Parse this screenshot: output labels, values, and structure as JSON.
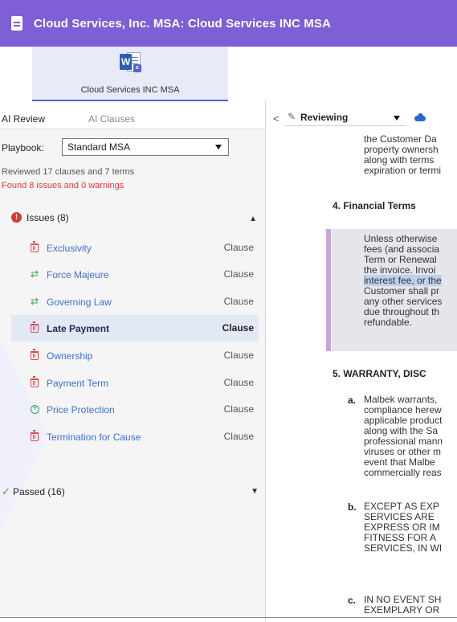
{
  "header": {
    "title": "Cloud Services, Inc. MSA: Cloud Services INC MSA"
  },
  "document_tab": {
    "label": "Cloud Services INC MSA"
  },
  "tabs": [
    {
      "label": "AI Review"
    },
    {
      "label": "AI Clauses"
    }
  ],
  "playbook": {
    "label": "Playbook:",
    "selected": "Standard MSA"
  },
  "summary": {
    "reviewed": "Reviewed 17 clauses and 7 terms",
    "found": "Found 8 issues and 0 warnings"
  },
  "issues": {
    "title": "Issues (8)",
    "items": [
      {
        "name": "Exclusivity",
        "kind": "Clause",
        "icon": "trash-icon"
      },
      {
        "name": "Force Majeure",
        "kind": "Clause",
        "icon": "swap-icon"
      },
      {
        "name": "Governing Law",
        "kind": "Clause",
        "icon": "swap-icon"
      },
      {
        "name": "Late Payment",
        "kind": "Clause",
        "icon": "trash-icon"
      },
      {
        "name": "Ownership",
        "kind": "Clause",
        "icon": "trash-icon"
      },
      {
        "name": "Payment Term",
        "kind": "Clause",
        "icon": "trash-icon"
      },
      {
        "name": "Price Protection",
        "kind": "Clause",
        "icon": "plus-circle-icon"
      },
      {
        "name": "Termination for Cause",
        "kind": "Clause",
        "icon": "trash-icon"
      }
    ]
  },
  "passed": {
    "title": "Passed (16)"
  },
  "toolbar": {
    "mode": "Reviewing"
  },
  "document": {
    "intro_lines": [
      "the Customer Da",
      "property ownersh",
      "along with terms",
      "expiration or termi"
    ],
    "section4": "4.  Financial Terms",
    "section4_lines": [
      "Unless otherwise",
      "fees (and associa",
      "Term or Renewal",
      "the invoice. Invoi",
      "interest fee, or the",
      "Customer shall pr",
      "any other services",
      "due throughout th",
      "refundable."
    ],
    "section5": "5.  WARRANTY, DISC",
    "item_a_mark": "a.",
    "item_a_lines": [
      "Malbek warrants,",
      "compliance herew",
      "applicable product",
      "along with the Sa",
      "professional mann",
      "viruses or other m",
      "event that Malbe",
      "commercially reas"
    ],
    "item_b_mark": "b.",
    "item_b_lines": [
      "EXCEPT AS EXP",
      "SERVICES ARE",
      "EXPRESS OR IM",
      "FITNESS FOR A",
      "SERVICES, IN WI"
    ],
    "item_c_mark": "c.",
    "item_c_lines": [
      "IN NO EVENT SH",
      "EXEMPLARY OR"
    ]
  }
}
